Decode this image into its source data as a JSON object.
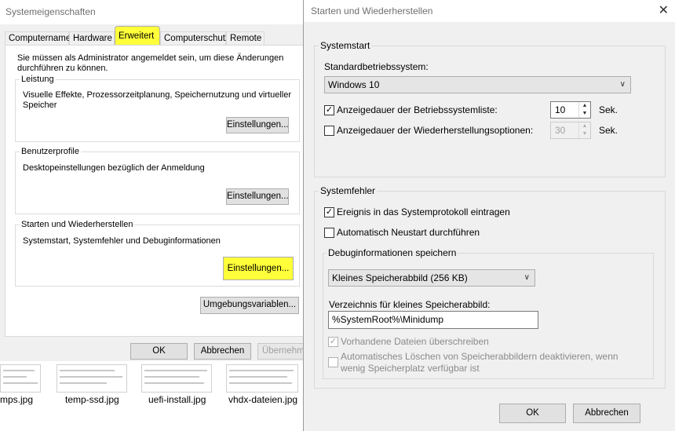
{
  "left_dialog": {
    "title": "Systemeigenschaften",
    "tabs": [
      "Computername",
      "Hardware",
      "Erweitert",
      "Computerschutz",
      "Remote"
    ],
    "admin_note_line1": "Sie müssen als Administrator angemeldet sein, um diese Änderungen",
    "admin_note_line2": "durchführen zu können.",
    "groups": [
      {
        "legend": "Leistung",
        "desc_line1": "Visuelle Effekte, Prozessorzeitplanung, Speichernutzung und virtueller",
        "desc_line2": "Speicher",
        "button": "Einstellungen..."
      },
      {
        "legend": "Benutzerprofile",
        "desc_line1": "Desktopeinstellungen bezüglich der Anmeldung",
        "desc_line2": "",
        "button": "Einstellungen..."
      },
      {
        "legend": "Starten und Wiederherstellen",
        "desc_line1": "Systemstart, Systemfehler und Debuginformationen",
        "desc_line2": "",
        "button": "Einstellungen..."
      }
    ],
    "env_button": "Umgebungsvariablen...",
    "ok": "OK",
    "cancel": "Abbrechen",
    "apply": "Übernehme"
  },
  "thumbnails": [
    "mps.jpg",
    "temp-ssd.jpg",
    "uefi-install.jpg",
    "vhdx-dateien.jpg"
  ],
  "right_dialog": {
    "title": "Starten und Wiederherstellen",
    "systemstart": {
      "legend": "Systemstart",
      "default_os_label": "Standardbetriebssystem:",
      "default_os_value": "Windows 10",
      "os_list_label": "Anzeigedauer der Betriebssystemliste:",
      "os_list_checked": true,
      "os_list_value": "10",
      "recovery_label": "Anzeigedauer der Wiederherstellungsoptionen:",
      "recovery_checked": false,
      "recovery_value": "30",
      "unit": "Sek."
    },
    "systemfehler": {
      "legend": "Systemfehler",
      "log_event_label": "Ereignis in das Systemprotokoll eintragen",
      "log_event_checked": true,
      "auto_restart_label": "Automatisch Neustart durchführen",
      "auto_restart_checked": false,
      "debug_legend": "Debuginformationen speichern",
      "dump_type": "Kleines Speicherabbild (256 KB)",
      "dir_label": "Verzeichnis für kleines Speicherabbild:",
      "dir_value": "%SystemRoot%\\Minidump",
      "overwrite_label": "Vorhandene Dateien überschreiben",
      "overwrite_checked": true,
      "auto_delete_line1": "Automatisches Löschen von Speicherabbildern deaktivieren, wenn",
      "auto_delete_line2": "wenig Speicherplatz verfügbar ist",
      "auto_delete_checked": false
    },
    "ok": "OK",
    "cancel": "Abbrechen"
  },
  "colors": {
    "highlight": "#ffff3a",
    "dialog_bg": "#f0f0f0"
  }
}
